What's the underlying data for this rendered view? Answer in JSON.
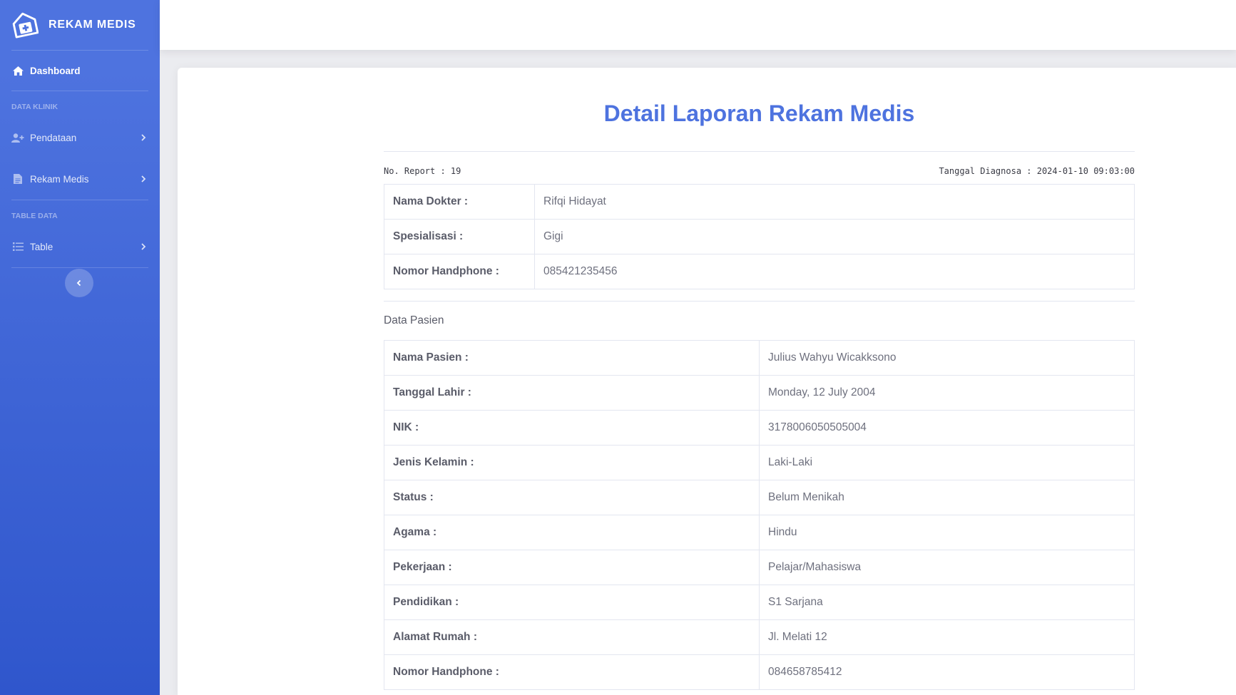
{
  "sidebar": {
    "brand": "REKAM MEDIS",
    "items": [
      {
        "label": "Dashboard",
        "icon": "home-icon"
      },
      {
        "heading": "DATA KLINIK"
      },
      {
        "label": "Pendataan",
        "icon": "user-plus-icon"
      },
      {
        "label": "Rekam Medis",
        "icon": "file-icon"
      },
      {
        "heading": "TABLE DATA"
      },
      {
        "label": "Table",
        "icon": "list-icon"
      }
    ]
  },
  "report": {
    "title": "Detail Laporan Rekam Medis",
    "no_report": "No. Report : 19",
    "tanggal": "Tanggal Diagnosa : 2024-01-10 09:03:00"
  },
  "dokter": [
    {
      "label": "Nama Dokter :",
      "value": "Rifqi Hidayat"
    },
    {
      "label": "Spesialisasi :",
      "value": "Gigi"
    },
    {
      "label": "Nomor Handphone :",
      "value": "085421235456"
    }
  ],
  "pasien_heading": "Data Pasien",
  "pasien": [
    {
      "label": "Nama Pasien :",
      "value": "Julius Wahyu Wicakksono"
    },
    {
      "label": "Tanggal Lahir :",
      "value": "Monday, 12 July 2004"
    },
    {
      "label": "NIK :",
      "value": "3178006050505004"
    },
    {
      "label": "Jenis Kelamin :",
      "value": "Laki-Laki"
    },
    {
      "label": "Status :",
      "value": "Belum Menikah"
    },
    {
      "label": "Agama :",
      "value": "Hindu"
    },
    {
      "label": "Pekerjaan :",
      "value": "Pelajar/Mahasiswa"
    },
    {
      "label": "Pendidikan :",
      "value": "S1 Sarjana"
    },
    {
      "label": "Alamat Rumah :",
      "value": "Jl. Melati 12"
    },
    {
      "label": "Nomor Handphone :",
      "value": "084658785412"
    }
  ],
  "colors": {
    "primary": "#4e73df",
    "sidebar_dark": "#2f56cc"
  }
}
